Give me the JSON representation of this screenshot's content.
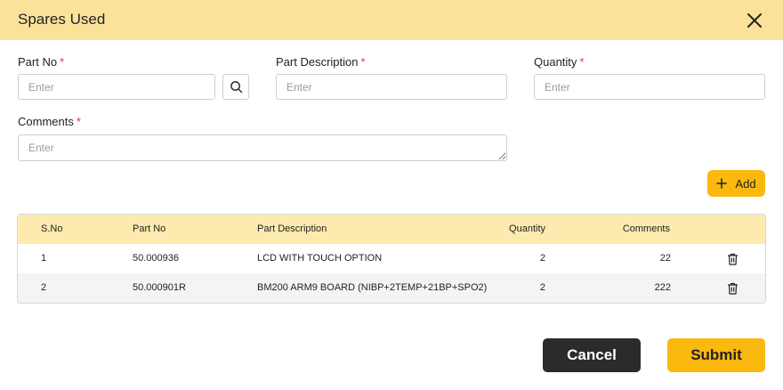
{
  "dialog": {
    "title": "Spares Used",
    "close_icon": "close-icon"
  },
  "form": {
    "part_no": {
      "label": "Part No",
      "required": "*",
      "placeholder": "Enter",
      "value": ""
    },
    "part_description": {
      "label": "Part Description",
      "required": "*",
      "placeholder": "Enter",
      "value": ""
    },
    "quantity": {
      "label": "Quantity",
      "required": "*",
      "placeholder": "Enter",
      "value": ""
    },
    "comments": {
      "label": "Comments",
      "required": "*",
      "placeholder": "Enter",
      "value": ""
    },
    "search_icon": "search-icon",
    "add_button": {
      "icon": "plus-icon",
      "label": "Add"
    }
  },
  "table": {
    "columns": [
      "S.No",
      "Part No",
      "Part Description",
      "Quantity",
      "Comments"
    ],
    "rows": [
      {
        "sno": "1",
        "part_no": "50.000936",
        "description": "LCD WITH TOUCH OPTION",
        "quantity": "2",
        "comments": "22",
        "action_icon": "trash-icon"
      },
      {
        "sno": "2",
        "part_no": "50.000901R",
        "description": "BM200 ARM9 BOARD (NIBP+2TEMP+21BP+SPO2)",
        "quantity": "2",
        "comments": "222",
        "action_icon": "trash-icon"
      }
    ]
  },
  "footer": {
    "cancel_label": "Cancel",
    "submit_label": "Submit"
  },
  "colors": {
    "header_bg": "#fbe29a",
    "accent": "#fbb80f",
    "table_header_bg": "#fdeaae",
    "required": "#e53935",
    "cancel_bg": "#2b2b2b"
  }
}
